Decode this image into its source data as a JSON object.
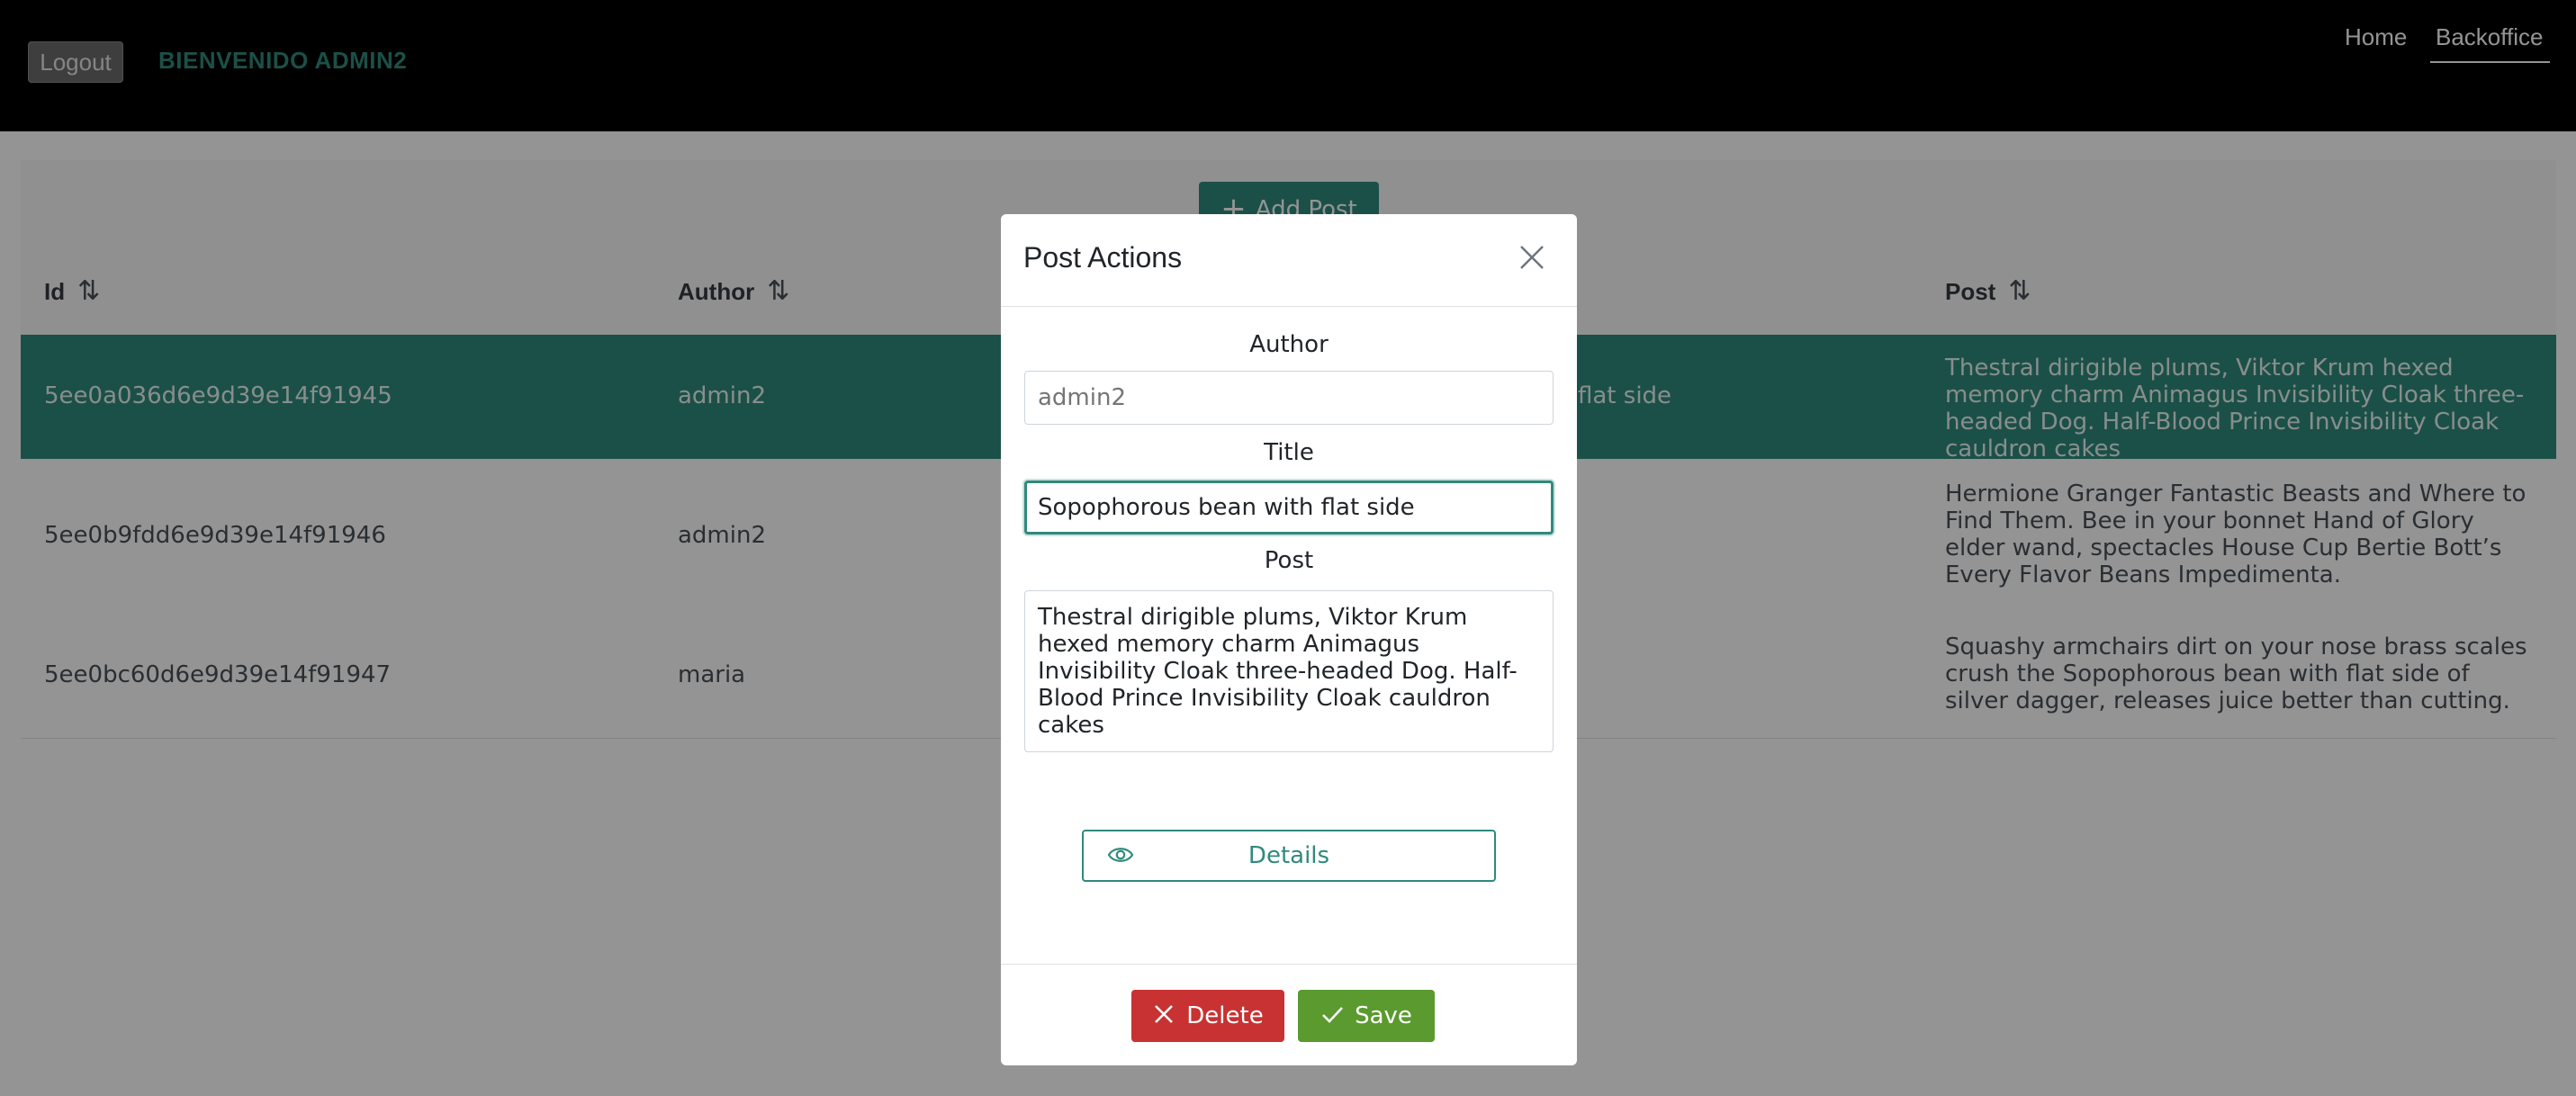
{
  "header": {
    "logout_label": "Logout",
    "welcome": "BIENVENIDO ADMIN2",
    "nav": {
      "home": "Home",
      "backoffice": "Backoffice"
    }
  },
  "toolbar": {
    "add_post_label": "Add Post",
    "add_icon": "plus-icon"
  },
  "table": {
    "columns": {
      "id": "Id",
      "author": "Author",
      "post": "Post",
      "sort_icon": "sort-arrows-icon"
    },
    "rows": [
      {
        "id": "5ee0a036d6e9d39e14f91945",
        "author": "admin2",
        "title_fragment": "flat side",
        "post": "Thestral dirigible plums, Viktor Krum hexed memory charm Animagus Invisibility Cloak three-headed Dog. Half-Blood Prince Invisibility Cloak cauldron cakes"
      },
      {
        "id": "5ee0b9fdd6e9d39e14f91946",
        "author": "admin2",
        "post": "Hermione Granger Fantastic Beasts and Where to Find Them. Bee in your bonnet Hand of Glory elder wand, spectacles House Cup Bertie Bott’s Every Flavor Beans Impedimenta."
      },
      {
        "id": "5ee0bc60d6e9d39e14f91947",
        "author": "maria",
        "post": "Squashy armchairs dirt on your nose brass scales crush the Sopophorous bean with flat side of silver dagger, releases juice better than cutting."
      }
    ]
  },
  "modal": {
    "title": "Post Actions",
    "close_icon": "close-icon",
    "author_label": "Author",
    "author_placeholder": "admin2",
    "title_label": "Title",
    "title_value": "Sopophorous bean with flat side",
    "post_label": "Post",
    "post_value": "Thestral dirigible plums, Viktor Krum hexed memory charm Animagus Invisibility Cloak three-headed Dog. Half-Blood Prince Invisibility Cloak cauldron cakes",
    "details_label": "Details",
    "details_icon": "eye-icon",
    "delete_label": "Delete",
    "delete_icon": "x-icon",
    "save_label": "Save",
    "save_icon": "check-icon"
  },
  "colors": {
    "accent": "#2f8a7d",
    "delete": "#c83232",
    "save": "#5a9a2e",
    "header_bg": "#000000"
  }
}
